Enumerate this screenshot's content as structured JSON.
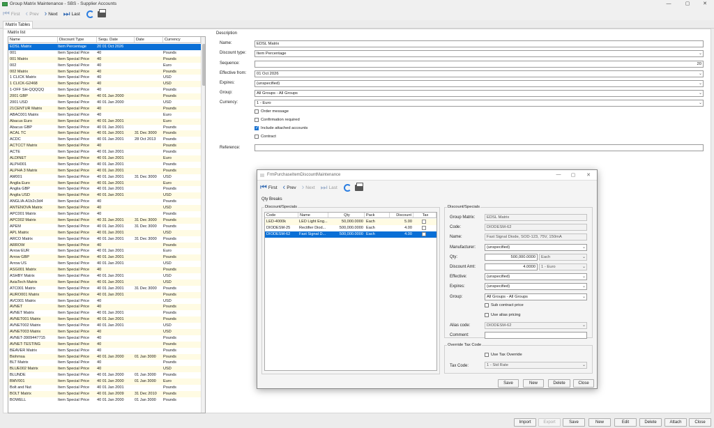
{
  "window": {
    "title": "Group Matrix Maintenance - SBS - Supplier Accounts",
    "min": "—",
    "max": "▢",
    "close": "✕"
  },
  "toolbar": {
    "first": "First",
    "prev": "Prev",
    "next": "Next",
    "last": "Last"
  },
  "tabs": [
    "Matrix Tables"
  ],
  "list": {
    "caption": "Matrix list",
    "columns": [
      "Name",
      "Discount Type",
      "Sequ. Date",
      "Date",
      "Currency"
    ],
    "rows": [
      [
        "EDSL Matrix",
        "Item Percentage",
        "20 01 Oct 2026",
        "",
        ""
      ],
      [
        "001",
        "Item Special Price",
        "40",
        "",
        "Pounds"
      ],
      [
        "001 Matrix",
        "Item Special Price",
        "40",
        "",
        "Pounds"
      ],
      [
        "002",
        "Item Special Price",
        "40",
        "",
        "Euro"
      ],
      [
        "002 Matrix",
        "Item Special Price",
        "40",
        "",
        "Pounds"
      ],
      [
        "1 CLICK Matrix",
        "Item Special Price",
        "40",
        "",
        "USD"
      ],
      [
        "1 CLICK-G2468",
        "Item Special Price",
        "40",
        "",
        "USD"
      ],
      [
        "1-OFF SH-QQQQQ",
        "Item Special Price",
        "40",
        "",
        "Pounds"
      ],
      [
        "2001 GBP",
        "Item Special Price",
        "40 01 Jan 2000",
        "",
        "Pounds"
      ],
      [
        "2001 USD",
        "Item Special Price",
        "40 01 Jan 2000",
        "",
        "USD"
      ],
      [
        "21CENTUR Matrix",
        "Item Special Price",
        "40",
        "",
        "Pounds"
      ],
      [
        "ABAC001 Matrix",
        "Item Special Price",
        "40",
        "",
        "Euro"
      ],
      [
        "Abacus Euro",
        "Item Special Price",
        "40 01 Jan 2001",
        "",
        "Euro"
      ],
      [
        "Abacus GBP",
        "Item Special Price",
        "40 01 Jan 2001",
        "",
        "Pounds"
      ],
      [
        "ACAL TC",
        "Item Special Price",
        "40 01 Jan 2001",
        "31 Dec 3000",
        "Pounds"
      ],
      [
        "ACDC",
        "Item Special Price",
        "40 01 Jan 2001",
        "28 Oct 2013",
        "Pounds"
      ],
      [
        "ACTCCT Matrix",
        "Item Special Price",
        "40",
        "",
        "Pounds"
      ],
      [
        "ACTE",
        "Item Special Price",
        "40 01 Jan 2001",
        "",
        "Pounds"
      ],
      [
        "ALDINET",
        "Item Special Price",
        "40 01 Jan 2001",
        "",
        "Euro"
      ],
      [
        "ALPH001",
        "Item Special Price",
        "40 01 Jan 2001",
        "",
        "Pounds"
      ],
      [
        "ALPHA 3 Matrix",
        "Item Special Price",
        "40 01 Jan 2001",
        "",
        "Pounds"
      ],
      [
        "AM001",
        "Item Special Price",
        "40 01 Jan 2001",
        "31 Dec 3000",
        "USD"
      ],
      [
        "Anglia Euro",
        "Item Special Price",
        "40 01 Jan 2001",
        "",
        "Euro"
      ],
      [
        "Anglia GBP",
        "Item Special Price",
        "40 01 Jan 2001",
        "",
        "Pounds"
      ],
      [
        "Anglia USD",
        "Item Special Price",
        "40 01 Jan 2001",
        "",
        "USD"
      ],
      [
        "ANGLIA-A1b2c3d4",
        "Item Special Price",
        "40",
        "",
        "Pounds"
      ],
      [
        "ANTENOVA Matrix",
        "Item Special Price",
        "40",
        "",
        "USD"
      ],
      [
        "APC001 Matrix",
        "Item Special Price",
        "40",
        "",
        "Pounds"
      ],
      [
        "APC002 Matrix",
        "Item Special Price",
        "40 31 Jan 2001",
        "31 Dec 3000",
        "Pounds"
      ],
      [
        "APEM",
        "Item Special Price",
        "40 01 Jan 2001",
        "31 Dec 3000",
        "Pounds"
      ],
      [
        "APL Matrix",
        "Item Special Price",
        "40 01 Jan 2001",
        "",
        "USD"
      ],
      [
        "ARCO Matrix",
        "Item Special Price",
        "40 01 Jan 2001",
        "31 Dec 3000",
        "Pounds"
      ],
      [
        "ARROW",
        "Item Special Price",
        "40",
        "",
        "Pounds"
      ],
      [
        "Arrow EUR",
        "Item Special Price",
        "40 01 Jan 2001",
        "",
        "Euro"
      ],
      [
        "Arrow GBP",
        "Item Special Price",
        "40 01 Jan 2001",
        "",
        "Pounds"
      ],
      [
        "Arrow US",
        "Item Special Price",
        "40 01 Jan 2001",
        "",
        "USD"
      ],
      [
        "ASG001 Matrix",
        "Item Special Price",
        "40",
        "",
        "Pounds"
      ],
      [
        "ASHBY Matrix",
        "Item Special Price",
        "40 01 Jan 2001",
        "",
        "USD"
      ],
      [
        "AsiaTech Matrix",
        "Item Special Price",
        "40 01 Jan 2001",
        "",
        "USD"
      ],
      [
        "ATC001 Matrix",
        "Item Special Price",
        "40 01 Jan 2001",
        "31 Dec 3000",
        "Pounds"
      ],
      [
        "AURO001 Matrix",
        "Item Special Price",
        "40 01 Jan 2001",
        "",
        "Pounds"
      ],
      [
        "AVC001 Matrix",
        "Item Special Price",
        "40",
        "",
        "USD"
      ],
      [
        "AVNET",
        "Item Special Price",
        "40",
        "",
        "Pounds"
      ],
      [
        "AVNET Matrix",
        "Item Special Price",
        "40 01 Jan 2001",
        "",
        "Pounds"
      ],
      [
        "AVNET001 Matrix",
        "Item Special Price",
        "40 01 Jan 2001",
        "",
        "Pounds"
      ],
      [
        "AVNET002 Matrix",
        "Item Special Price",
        "40 01 Jan 2001",
        "",
        "USD"
      ],
      [
        "AVNET003 Matrix",
        "Item Special Price",
        "40",
        "",
        "USD"
      ],
      [
        "AVNET-3909447715",
        "Item Special Price",
        "40",
        "",
        "Pounds"
      ],
      [
        "AVNET-TESTING",
        "Item Special Price",
        "40",
        "",
        "Pounds"
      ],
      [
        "BEAVER Matrix",
        "Item Special Price",
        "40",
        "",
        "Pounds"
      ],
      [
        "Biohmsa",
        "Item Special Price",
        "40 01 Jan 2000",
        "01 Jan 3000",
        "Pounds"
      ],
      [
        "BLT Matrix",
        "Item Special Price",
        "40",
        "",
        "Pounds"
      ],
      [
        "BLUE002 Matrix",
        "Item Special Price",
        "40",
        "",
        "USD"
      ],
      [
        "BLUNDE",
        "Item Special Price",
        "40 01 Jan 2000",
        "01 Jan 3000",
        "Pounds"
      ],
      [
        "BMV001",
        "Item Special Price",
        "40 01 Jan 2000",
        "01 Jan 3000",
        "Euro"
      ],
      [
        "Bolt and Nut",
        "Item Special Price",
        "40 01 Jan 2001",
        "",
        "Pounds"
      ],
      [
        "BOLT Matrix",
        "Item Special Price",
        "40 01 Jan 2009",
        "31 Dec 2010",
        "Pounds"
      ],
      [
        "BOWELL",
        "Item Special Price",
        "40 01 Jan 2000",
        "01 Jan 3000",
        "Pounds"
      ]
    ]
  },
  "detail": {
    "section_label": "Description",
    "name_label": "Name:",
    "name_value": "EDSL Matrix",
    "discount_type_label": "Discount type:",
    "discount_type_value": "Item Percentage",
    "sequence_label": "Sequence:",
    "sequence_value": "20",
    "effective_label": "Effective from:",
    "effective_value": "01 Oct 2026",
    "expires_label": "Expires:",
    "expires_value": "(unspecified)",
    "group_label": "Group:",
    "group_value": "All Groups - All Groups",
    "currency_label": "Currency:",
    "currency_value": "1 - Euro",
    "order_message": "Order message",
    "confirmation_required": "Confirmation required",
    "include_attached": "Include attached accounts",
    "contract": "Contract",
    "reference_label": "Reference:",
    "reference_value": ""
  },
  "bottom_buttons": {
    "import": "Import",
    "export": "Export",
    "save": "Save",
    "new": "New",
    "edit": "Edit",
    "delete": "Delete",
    "attach": "Attach",
    "close": "Close"
  },
  "modal": {
    "title": "FrmPurchaseItemDiscountMaintenance",
    "qty_breaks": "Qty Breaks",
    "group_left": "Discount/Specials",
    "group_right": "Discount/Specials",
    "grid_columns": [
      "Code",
      "Name",
      "Qty",
      "Pack",
      "Discount",
      "Tax"
    ],
    "grid_rows": [
      [
        "LED-4000k",
        "LED Light Eng...",
        "50,000.0000",
        "Each",
        "5.00"
      ],
      [
        "DIODESM-25",
        "Rectifier Diod...",
        "500,000.0000",
        "Each",
        "4.00"
      ],
      [
        "DIODESM-62",
        "Fast Signal D...",
        "500,000.0000",
        "Each",
        "4.00"
      ]
    ],
    "group_matrix_label": "Group Matrix:",
    "group_matrix_value": "EDSL Matrix",
    "code_label": "Code:",
    "code_value": "DIODESM-62",
    "name_label": "Name:",
    "name_value": "Fast Signal Diode, SOD-123, 75V, 150mA",
    "manufacturer_label": "Manufacturer:",
    "manufacturer_value": "(unspecified)",
    "qty_label": "Qty:",
    "qty_value": "500,000.0000",
    "qty_unit": "Each",
    "discount_amt_label": "Discount Amt:",
    "discount_amt_value": "4.0000",
    "discount_currency": "1 - Euro",
    "effective_label": "Effective:",
    "effective_value": "(unspecified)",
    "expires_label": "Expires:",
    "expires_value": "(unspecified)",
    "group_label": "Group:",
    "group_value": "All Groups - All Groups",
    "sub_contract": "Sub contract price",
    "use_alias": "Use alias pricing",
    "alias_label": "Alias code:",
    "alias_value": "DIODESM-62",
    "comment_label": "Comment:",
    "comment_value": "",
    "override_label": "Override Tax Code",
    "use_tax_override": "Use Tax Override",
    "tax_code_label": "Tax Code:",
    "tax_code_value": "1 - Std Rate",
    "save": "Save",
    "new": "New",
    "delete": "Delete",
    "close": "Close"
  },
  "colors": {
    "selection": "#0a6fd6",
    "accent": "#2a7de1",
    "row_alt": "#fffbe3"
  }
}
